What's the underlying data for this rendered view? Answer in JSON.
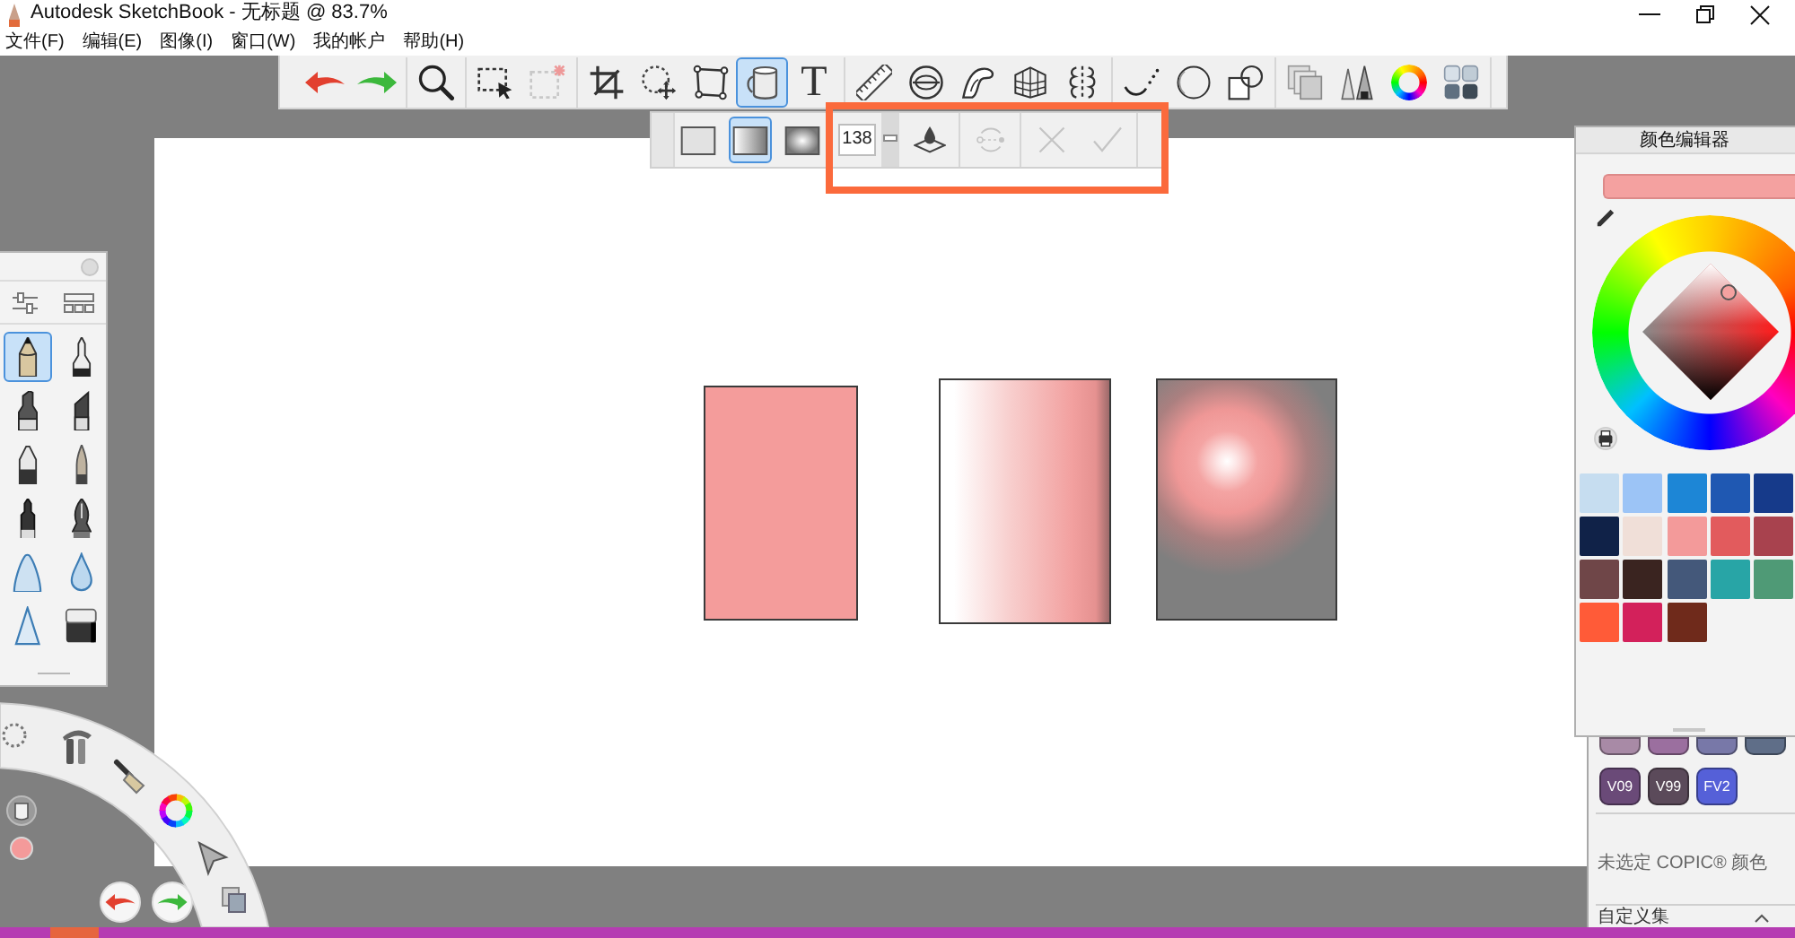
{
  "window": {
    "title": "Autodesk SketchBook - 无标题 @ 83.7%"
  },
  "menu": [
    "文件(F)",
    "编辑(E)",
    "图像(I)",
    "窗口(W)",
    "我的帐户",
    "帮助(H)"
  ],
  "toolbar": {
    "groups": [
      [
        {
          "kind": "undo",
          "selected": false
        },
        {
          "kind": "redo",
          "selected": false
        }
      ],
      [
        {
          "kind": "zoom",
          "selected": false
        }
      ],
      [
        {
          "kind": "marquee",
          "selected": false
        },
        {
          "kind": "marqueeclear",
          "selected": false
        }
      ],
      [
        {
          "kind": "crop",
          "selected": false
        },
        {
          "kind": "transform",
          "selected": false
        },
        {
          "kind": "distort",
          "selected": false
        },
        {
          "kind": "fill",
          "selected": true
        },
        {
          "kind": "text",
          "label": "T",
          "selected": false
        }
      ],
      [
        {
          "kind": "ruler",
          "selected": false
        },
        {
          "kind": "ellipse",
          "selected": false
        },
        {
          "kind": "french",
          "selected": false
        },
        {
          "kind": "perspective",
          "selected": false
        },
        {
          "kind": "symmetry",
          "selected": false
        }
      ],
      [
        {
          "kind": "stroke",
          "selected": false
        },
        {
          "kind": "circle",
          "selected": false
        },
        {
          "kind": "shape",
          "selected": false
        }
      ],
      [
        {
          "kind": "layers",
          "selected": false
        },
        {
          "kind": "brushes",
          "selected": false
        },
        {
          "kind": "colorwheel",
          "selected": false
        },
        {
          "kind": "copic",
          "selected": false
        }
      ]
    ]
  },
  "fill_options": {
    "types": [
      {
        "kind": "solid",
        "selected": false
      },
      {
        "kind": "linear",
        "selected": true
      },
      {
        "kind": "radial",
        "selected": false
      }
    ],
    "opacity": {
      "value": "138",
      "level": 0.54
    },
    "actions": [
      {
        "kind": "sample",
        "disabled": false
      },
      {
        "kind": "cycle",
        "disabled": true
      },
      {
        "kind": "cancel",
        "disabled": true
      },
      {
        "kind": "accept",
        "disabled": true
      }
    ]
  },
  "canvas": {
    "shapes": [
      {
        "kind": "solid"
      },
      {
        "kind": "linear"
      },
      {
        "kind": "radial"
      }
    ]
  },
  "brush_palette": {
    "brushes": [
      {
        "kind": "pencil",
        "selected": true
      },
      {
        "kind": "technical",
        "selected": false
      },
      {
        "kind": "marker",
        "selected": false
      },
      {
        "kind": "chisel",
        "selected": false
      },
      {
        "kind": "ballpen",
        "selected": false
      },
      {
        "kind": "paintbrush",
        "selected": false
      },
      {
        "kind": "felt",
        "selected": false
      },
      {
        "kind": "nib",
        "selected": false
      },
      {
        "kind": "airbrush",
        "selected": false
      },
      {
        "kind": "water",
        "selected": false
      },
      {
        "kind": "cone",
        "selected": false
      },
      {
        "kind": "eraser",
        "selected": false
      }
    ]
  },
  "color_editor": {
    "title": "颜色编辑器",
    "swatches": [
      {
        "color": "#c6ddf0"
      },
      {
        "color": "#9cc4f6"
      },
      {
        "color": "#1d86d6"
      },
      {
        "color": "#1f58b2"
      },
      {
        "color": "#163a8a"
      },
      {
        "color": "#102248"
      },
      {
        "color": "#f0dfd8"
      },
      {
        "color": "#f39a9a"
      },
      {
        "color": "#e25b5d"
      },
      {
        "color": "#a8424e"
      },
      {
        "color": "#6f4648"
      },
      {
        "color": "#3a2420"
      },
      {
        "color": "#44587a"
      },
      {
        "color": "#28a5a6"
      },
      {
        "color": "#4f9a76"
      },
      {
        "color": "#ff5b38"
      },
      {
        "color": "#d3215b"
      },
      {
        "color": "#6f2a1b"
      }
    ]
  },
  "copic": {
    "rows": [
      [
        {
          "color": "#a88aa6"
        },
        {
          "color": "#9b6f9f"
        },
        {
          "color": "#7878a8"
        },
        {
          "color": "#5f6e88"
        }
      ],
      [
        {
          "label": "V09",
          "color": "#6a4a78"
        },
        {
          "label": "V99",
          "color": "#5b4a5a"
        },
        {
          "label": "FV2",
          "color": "#5560d8"
        }
      ]
    ],
    "status": "未选定 COPIC® 颜色",
    "set": "自定义集"
  }
}
